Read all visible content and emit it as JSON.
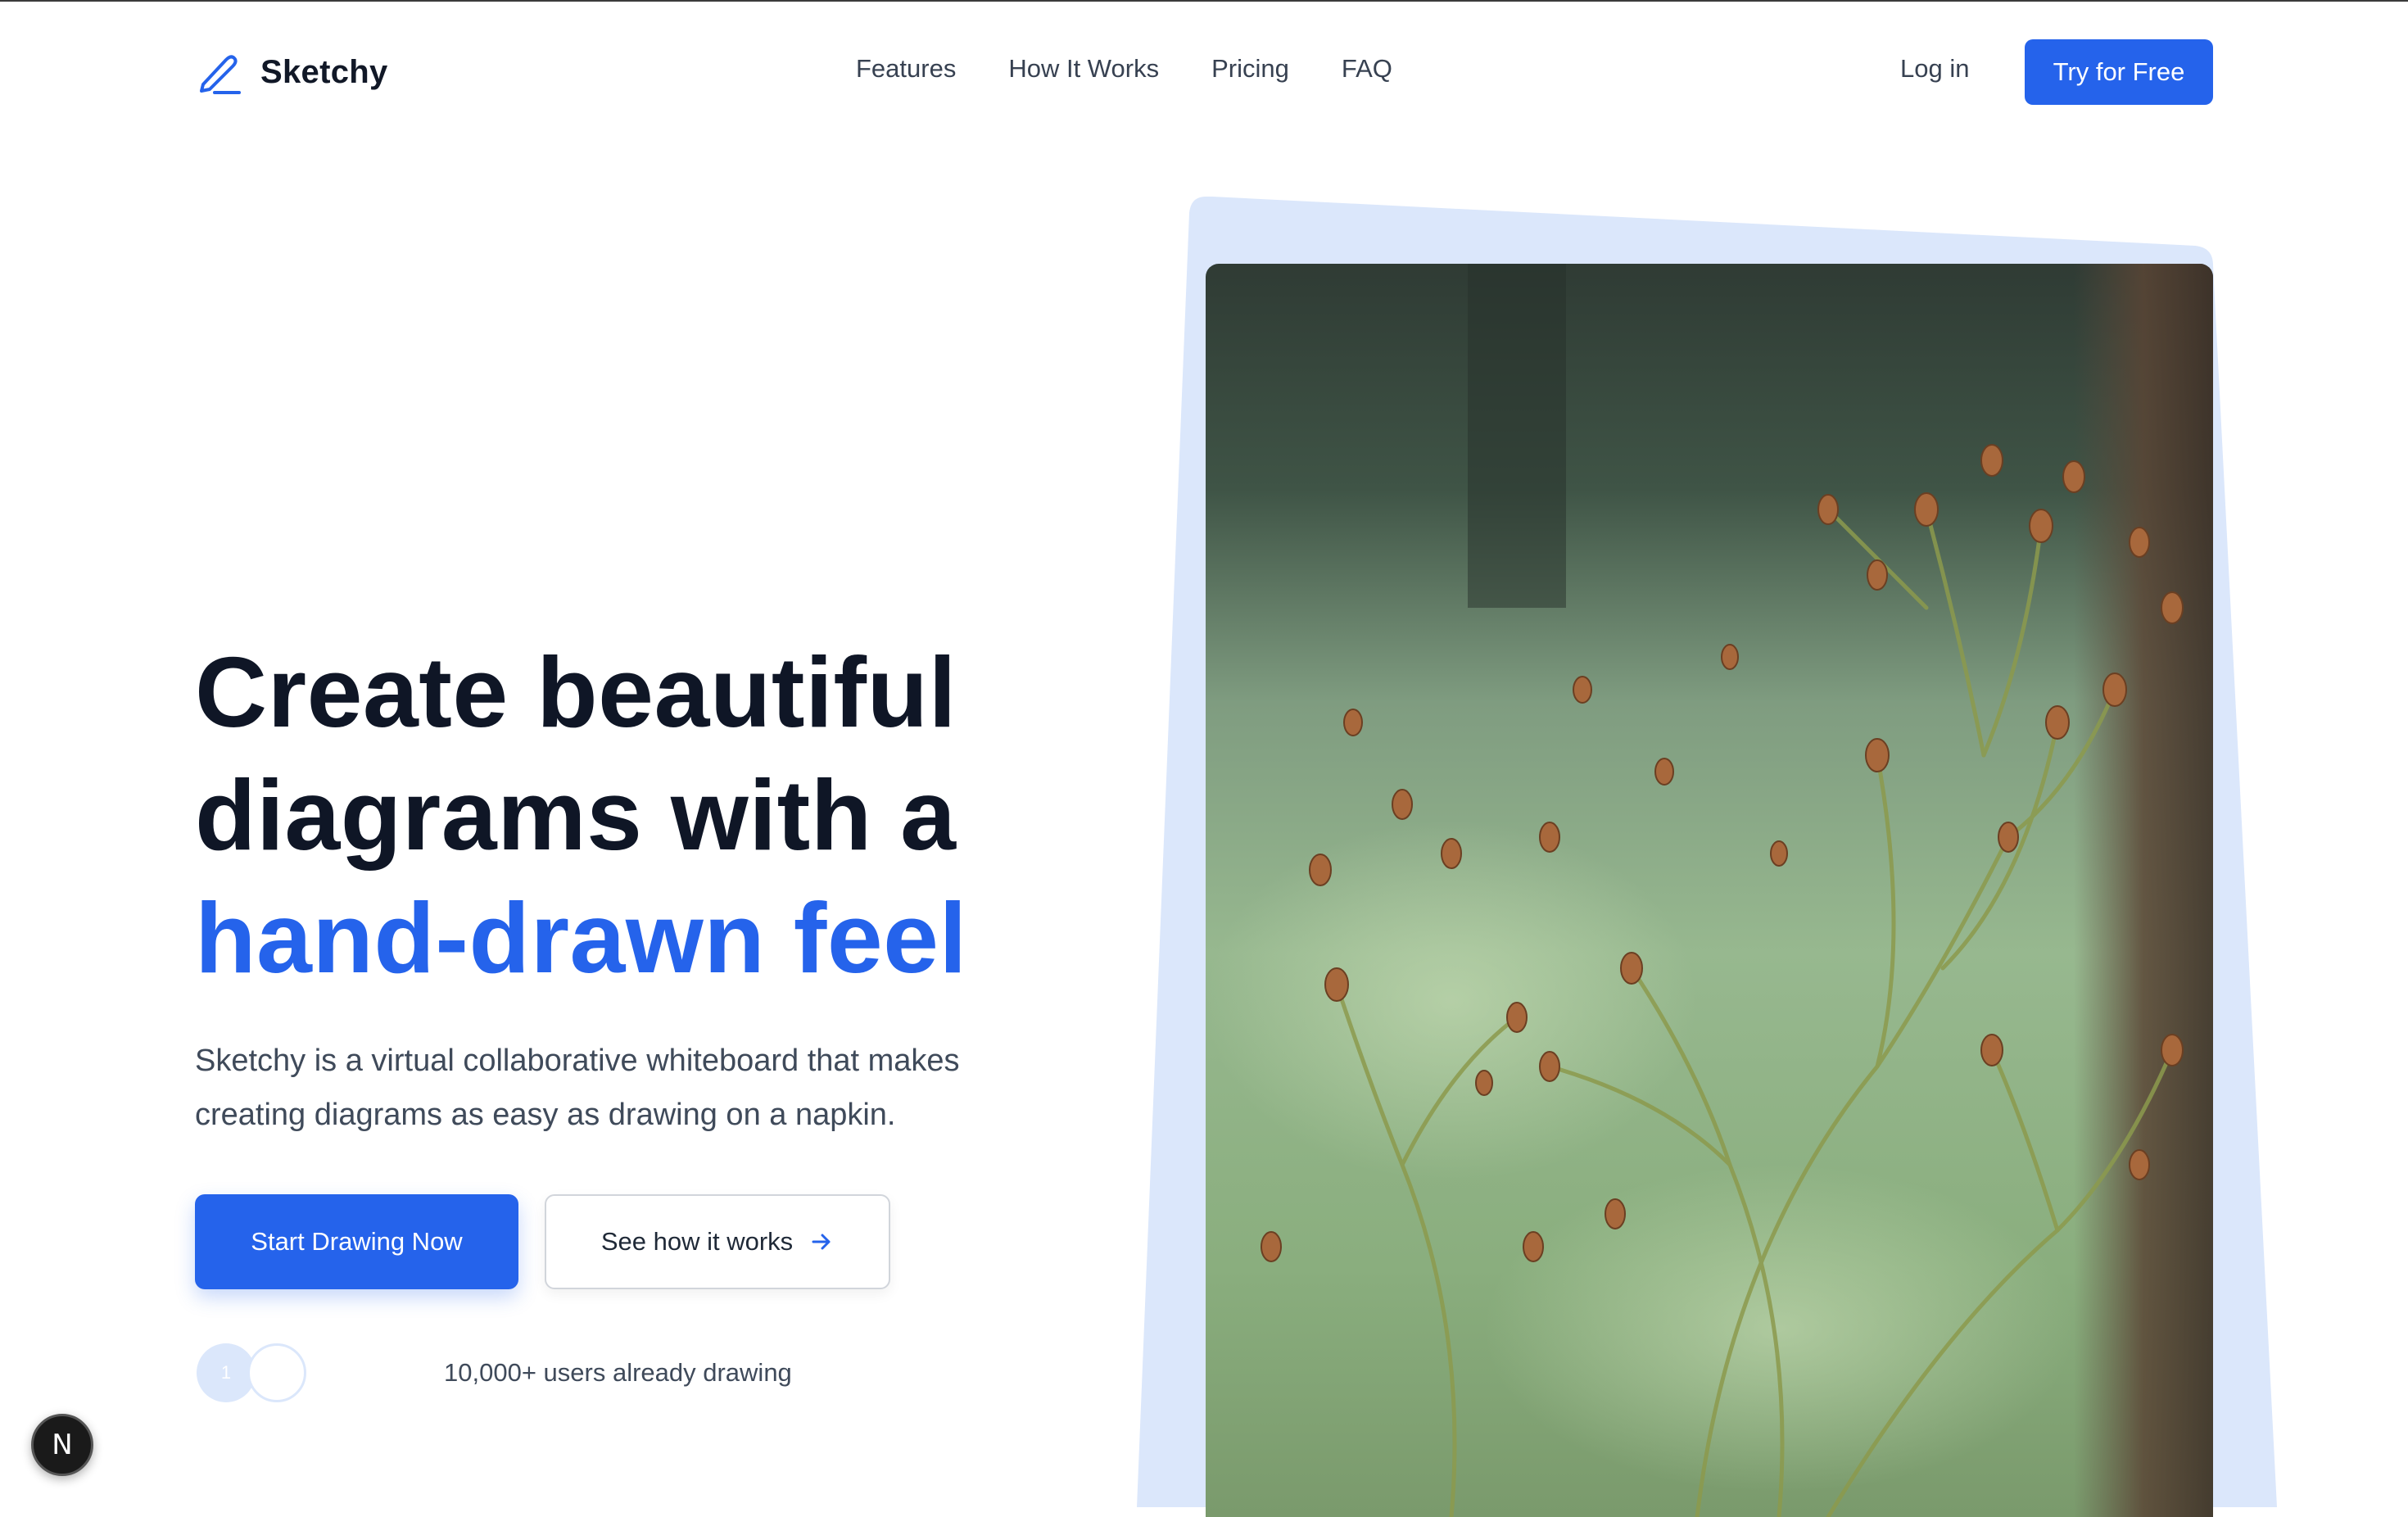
{
  "brand": {
    "name": "Sketchy",
    "logo_icon": "pen-icon",
    "accent_color": "#2563eb"
  },
  "nav": {
    "items": [
      {
        "label": "Features"
      },
      {
        "label": "How It Works"
      },
      {
        "label": "Pricing"
      },
      {
        "label": "FAQ"
      }
    ],
    "login_label": "Log in",
    "cta_label": "Try for Free"
  },
  "hero": {
    "title_line1": "Create beautiful",
    "title_line2": "diagrams with a",
    "title_accent": "hand-drawn feel",
    "subtitle": "Sketchy is a virtual collaborative whiteboard that makes creating diagrams as easy as drawing on a napkin.",
    "primary_button": "Start Drawing Now",
    "secondary_button": "See how it works",
    "secondary_icon": "arrow-right-icon",
    "avatar_initial": "1",
    "users_text": "10,000+ users already drawing"
  },
  "dev_badge": {
    "letter": "N",
    "icon": "nextjs-icon"
  }
}
